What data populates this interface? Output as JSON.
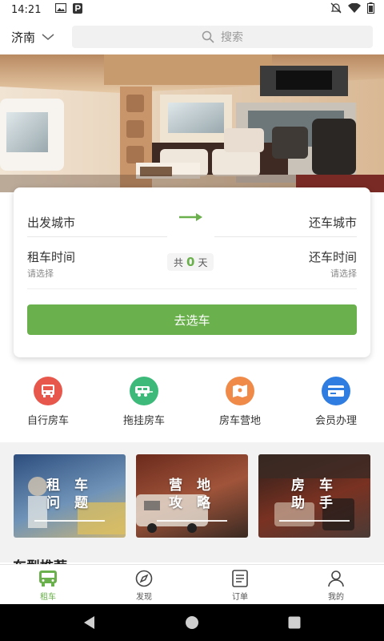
{
  "status": {
    "time": "14:21"
  },
  "search": {
    "city": "济南",
    "placeholder": "搜索"
  },
  "booking": {
    "from_city": "出发城市",
    "to_city": "还车城市",
    "rent_time": "租车时间",
    "rent_hint": "请选择",
    "return_time": "还车时间",
    "return_hint": "请选择",
    "days_prefix": "共",
    "days_count": "0",
    "days_suffix": "天",
    "button": "去选车"
  },
  "quick_links": [
    {
      "label": "自行房车",
      "icon": "bus-icon",
      "color": "#e8574c"
    },
    {
      "label": "拖挂房车",
      "icon": "trailer-icon",
      "color": "#3dba7a"
    },
    {
      "label": "房车营地",
      "icon": "map-icon",
      "color": "#f08a48"
    },
    {
      "label": "会员办理",
      "icon": "card-icon",
      "color": "#2f7de1"
    }
  ],
  "tiles": [
    {
      "line1": "租 车",
      "line2": "问 题"
    },
    {
      "line1": "营 地",
      "line2": "攻 略"
    },
    {
      "line1": "房 车",
      "line2": "助 手"
    }
  ],
  "section_title": "车型推荐",
  "tabs": [
    {
      "label": "租车",
      "icon": "bus-icon",
      "active": true
    },
    {
      "label": "发现",
      "icon": "compass-icon",
      "active": false
    },
    {
      "label": "订单",
      "icon": "list-icon",
      "active": false
    },
    {
      "label": "我的",
      "icon": "user-icon",
      "active": false
    }
  ],
  "colors": {
    "accent": "#6ab04c"
  }
}
